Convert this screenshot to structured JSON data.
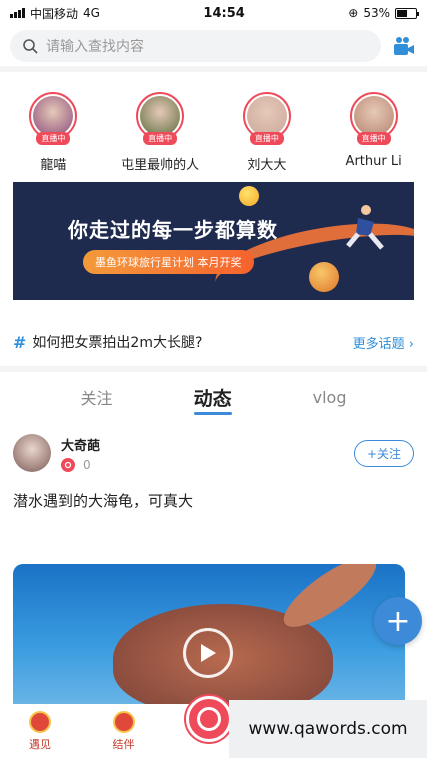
{
  "status_bar": {
    "carrier": "中国移动",
    "network": "4G",
    "time": "14:54",
    "battery_percent": "53%",
    "battery_level": 0.53
  },
  "search": {
    "placeholder": "请输入查找内容"
  },
  "live_users": [
    {
      "name": "龍喵",
      "badge": "直播中",
      "avatar_color": "#8a4a7a"
    },
    {
      "name": "屯里最帅的人",
      "badge": "直播中",
      "avatar_color": "#5b6b3c"
    },
    {
      "name": "刘大大",
      "badge": "直播中",
      "avatar_color": "#c9a79a"
    },
    {
      "name": "Arthur Li",
      "badge": "直播中",
      "avatar_color": "#b5836c"
    }
  ],
  "banner": {
    "headline": "你走过的每一步都算数",
    "pill": "墨鱼环球旅行星计划 本月开奖"
  },
  "topic": {
    "hash": "#",
    "question": "如何把女票拍出2m大长腿?",
    "more": "更多话题 ›"
  },
  "tabs": [
    {
      "label": "关注"
    },
    {
      "label": "动态"
    },
    {
      "label": "vlog"
    }
  ],
  "post": {
    "username": "大奇葩",
    "count": "0",
    "follow_label": "+关注",
    "text": "潜水遇到的大海龟，可真大"
  },
  "fab": {
    "label": "+"
  },
  "bottom_nav": [
    {
      "label": "遇见"
    },
    {
      "label": "结伴"
    }
  ],
  "watermark": {
    "text": "www.qawords.com"
  }
}
